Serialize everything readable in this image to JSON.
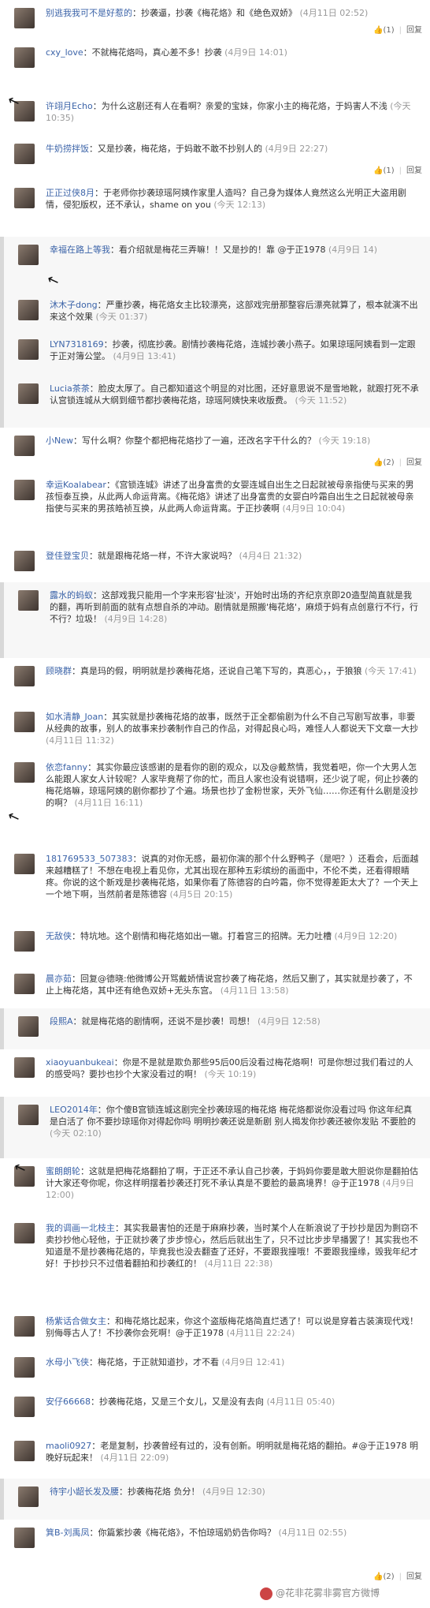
{
  "icons": {
    "like": "👍",
    "cursor": "↖"
  },
  "labels": {
    "reply": "回复"
  },
  "comments": [
    {
      "name": "别逃我我可不是好惹的",
      "text": "：抄袭逼，抄袭《梅花烙》和《绝色双娇》",
      "time": "(4月11日 02:52)",
      "likes": "(1)"
    },
    {
      "name": "cxy_love",
      "text": "：不就梅花烙吗，真心差不多！抄袭",
      "time": "(4月9日 14:01)"
    },
    {
      "name": "许翊月Echo",
      "text": "：为什么这剧还有人在看啊？亲爱的宝妹，你家小主的梅花烙，于妈害人不浅",
      "time": "(今天 10:35)"
    },
    {
      "name": "牛奶捞拌饭",
      "text": "：又是抄袭，梅花烙，于妈敢不敢不抄别人的",
      "time": "(4月9日 22:27)",
      "likes": "(1)"
    },
    {
      "name": "正正过侠8月",
      "text": "：于老师你抄袭琼瑶阿姨作家里人造吗？自己身为媒体人竟然这么光明正大盗用剧情，侵犯版权，还不承认，shame on you",
      "time": "(今天 12:13)"
    },
    {
      "name": "幸福在路上等我",
      "text": "：看介绍就是梅花三弄嘛！！又是抄的！靠 @于正1978",
      "time": "(4月9日 14)"
    },
    {
      "name": "沐木子dong",
      "text": "：严重抄袭，梅花烙女主比较漂亮，这部戏完册那整容后漂亮就算了，根本就演不出来这个效果",
      "time": "(今天 01:37)"
    },
    {
      "name": "LYN7318169",
      "text": "：抄袭，彻底抄袭。剧情抄袭梅花烙，连城抄袭小燕子。如果琼瑶阿姨看到一定跟于正对簿公堂。",
      "time": "(4月9日 13:41)"
    },
    {
      "name": "Lucia茶茶",
      "text": "：脸皮太厚了。自己都知道这个明显的对比图，还好意思说不是雪地靴，就跟打死不承认宫锁连城从大纲到细节都抄袭梅花烙，琼瑶阿姨快来收版费。",
      "time": "(今天 11:52)"
    },
    {
      "name": "小New",
      "text": "：写什么啊？你整个都把梅花烙抄了一遍，还改名字干什么的？",
      "time": "(今天 19:18)",
      "likes": "(2)"
    },
    {
      "name": "幸运Koalabear",
      "text": "：《宫锁连城》讲述了出身富贵的女婴连城自出生之日起就被母亲指使与买来的男孩恒泰互换，从此两人命运背离。《梅花烙》讲述了出身富贵的女婴白吟霜自出生之日起就被母亲指使与买来的男孩皓祯互换，从此两人命运背离。于正抄袭啊",
      "time": "(4月9日 10:04)"
    },
    {
      "name": "登佳登宝贝",
      "text": "：就是跟梅花烙一样，不许大家说吗？",
      "time": "(4月4日 21:32)"
    },
    {
      "name": "露水的蚂蚁",
      "text": "：这部戏我只能用一个字来形容'扯淡'，开始时出场的齐纪京京即20造型简直就是我的翻，再听到前面的就有点想自杀的冲动。剧情就是照搬'梅花烙'，麻烦于妈有点创意行不行，行不行？垃圾！",
      "time": "(4月9日 14:28)"
    },
    {
      "name": "顾晓群",
      "text": "：真是玛的假，明明就是抄袭梅花烙，还说自己笔下写的，真恶心，，于狼狼",
      "time": "(今天 17:41)"
    },
    {
      "name": "如水清静_Joan",
      "text": "：其实就是抄袭梅花烙的故事，既然于正全都偷剧为什么不自己写剧写故事，非要从经典的故事，别人的故事来抄袭制作自己的作品，对得起良心吗，难怪人人都说天下文章一大抄",
      "time": "(4月11日 11:32)"
    },
    {
      "name": "依恋fanny",
      "text": "：其实你最应该感谢的是看你的剧的观众，以及@戴熬情，我觉着吧，你一个大男人怎么能跟人家女人计较呢？人家毕竟帮了你的忙，而且人家也没有说错啊，还少说了呢，何止抄袭的梅花烙嘛，琼瑶阿姨的剧你都抄了个遍。场景也抄了金粉世家，天外飞仙……你还有什么剧是没抄的啊？",
      "time": "(4月11日 16:11)"
    },
    {
      "name": "181769533_507383",
      "text": "：说真的对你无感，最初你演的那个什么野鸭子（是吧？）还看会，后面越来越糟糕了！不想在电视上看见你，尤其出现在那种五彩缤纷的画面中，不伦不类，还看得眼睛疼。你说的这个新戏是抄袭梅花烙，如果你看了陈德容的白吟霜，你不觉得差距太大了？一个天上一个地下啊，当然前者是陈德容",
      "time": "(4月5日 20:15)"
    },
    {
      "name": "无敌侠",
      "text": "：特坑地。这个剧情和梅花烙如出一辙。打着宫三的招牌。无力吐槽",
      "time": "(4月9日 12:20)"
    },
    {
      "name": "晨亦茹",
      "text": "：回复@德晓:他微博公开骂戴娇情说宫抄袭了梅花烙，然后又删了，其实就是抄袭了，不止上梅花烙，其中还有绝色双娇+无头东宫。",
      "time": "(4月11日 13:58)"
    },
    {
      "name": "段熙A",
      "text": "：就是梅花烙的剧情啊，还说不是抄袭！司想！",
      "time": "(4月9日 12:58)"
    },
    {
      "name": "xiaoyuanbukeai",
      "text": "：你是不是就是欺负那些95后00后没看过梅花烙啊！可是你想过我们看过的人的感受吗？要抄也抄个大家没看过的啊！",
      "time": "(今天 10:19)"
    },
    {
      "name": "LEO2014年",
      "text": "：你个傻B宫锁连城这剧完全抄袭琼瑶的梅花烙 梅花烙都说你没看过吗 你这年纪真是白活了 你不要抄琼瑶你对得起你吗 明明抄袭还说是新剧 别人揭发你抄袭还被你发贴 不要脸的",
      "time": "(今天 02:10)"
    },
    {
      "name": "蜜朗朗轮",
      "text": "：这就是把梅花烙翻拍了啊，于正还不承认自己抄袭，于妈妈你要是敢大胆说你是翻拍估计大家还夸你呢，你这样明摆着抄袭还打死不承认真是不要脸的最高境界！@于正1978",
      "time": "(4月9日 12:00)"
    },
    {
      "name": "我的调画一北枝主",
      "text": "：其实我最害怕的还是于麻麻抄袭，当时某个人在新浪说了于抄抄是因为剽窃不卖抄抄他心轻他，于正就抄袭了步步惊心，然后后就出生了，只不过比步步早播罢了！其实我也不知道是不是抄袭梅花烙的，毕竟我也没去翻查了还好，不要跟我撞哦！不要跟我撞缘，毁我年纪才好！于抄抄只不过借着翻拍和抄袭红的！",
      "time": "(4月11日 22:38)"
    },
    {
      "name": "杨紫话合做女主",
      "text": "：和梅花烙比起来，你这个盗版梅花烙简直烂透了！可以说是穿着古装演现代戏！别侮辱古人了！不抄袭你会死啊！@于正1978",
      "time": "(4月11日 22:24)"
    },
    {
      "name": "水母小飞侠",
      "text": "：梅花烙，于正就知道抄，才不看",
      "time": "(4月9日 12:41)"
    },
    {
      "name": "安仔66668",
      "text": "：抄袭梅花烙，又是三个女儿，又是没有去向",
      "time": "(4月11日 05:40)"
    },
    {
      "name": "maoli0927",
      "text": "：老是复制，抄袭曾经有过的，没有创新。明明就是梅花烙的翻拍。#@于正1978 明晚好玩起来！",
      "time": "(4月11日 22:09)"
    },
    {
      "name": "待宇小龆长发及腰",
      "text": "：抄袭梅花烙 负分！",
      "time": "(4月9日 12:30)"
    },
    {
      "name": "箕B-刘禹凤",
      "text": "：你篇紫抄袭《梅花烙》，不怕琼瑶奶奶告你吗？",
      "time": "(4月11日 02:55)",
      "likes": "(2)"
    }
  ],
  "watermark": "@花非花雾非雾官方微博"
}
